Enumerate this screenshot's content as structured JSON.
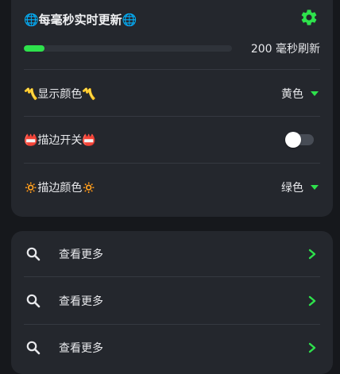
{
  "settings": {
    "title": "🌐每毫秒实时更新🌐",
    "progress": 0.1,
    "refresh_label": "200 毫秒刷新",
    "color_label": "〽️显示颜色〽️",
    "color_value": "黄色",
    "outline_label": "📛描边开关📛",
    "outline_enabled": false,
    "outline_color_label": "🔅描边颜色🔅",
    "outline_color_value": "绿色"
  },
  "links": [
    {
      "label": "查看更多"
    },
    {
      "label": "查看更多"
    },
    {
      "label": "查看更多"
    }
  ],
  "colors": {
    "accent": "#2ee24c",
    "card": "#24272d",
    "background": "#16181c"
  }
}
